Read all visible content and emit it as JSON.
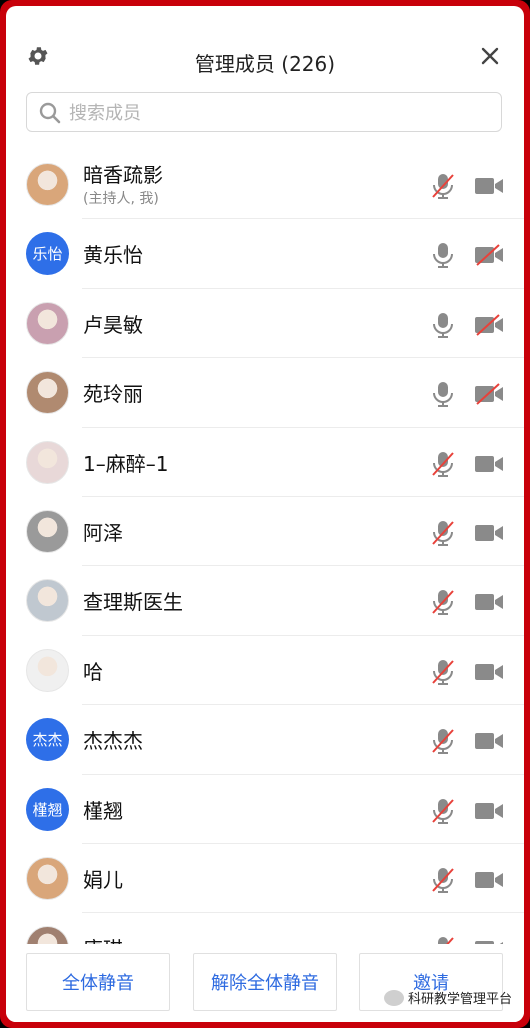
{
  "header": {
    "title": "管理成员 (226)"
  },
  "search": {
    "placeholder": "搜索成员"
  },
  "members": [
    {
      "name": "暗香疏影",
      "sub": "(主持人, 我)",
      "avatar": "photo",
      "mic": "muted",
      "cam": "on"
    },
    {
      "name": "黄乐怡",
      "avatar_text": "乐怡",
      "mic": "on",
      "cam": "off"
    },
    {
      "name": "卢昊敏",
      "avatar": "photo",
      "mic": "on",
      "cam": "off"
    },
    {
      "name": "苑玲丽",
      "avatar": "photo",
      "mic": "on",
      "cam": "off"
    },
    {
      "name": "1–麻醉–1",
      "avatar": "photo",
      "mic": "muted",
      "cam": "on"
    },
    {
      "name": "阿泽",
      "avatar": "photo",
      "mic": "muted",
      "cam": "on"
    },
    {
      "name": "查理斯医生",
      "avatar": "photo",
      "mic": "muted",
      "cam": "on"
    },
    {
      "name": "哈",
      "avatar": "photo",
      "mic": "muted",
      "cam": "on"
    },
    {
      "name": "杰杰杰",
      "avatar_text": "杰杰",
      "mic": "muted",
      "cam": "on"
    },
    {
      "name": "槿翘",
      "avatar_text": "槿翘",
      "mic": "muted",
      "cam": "on"
    },
    {
      "name": "娟儿",
      "avatar": "photo",
      "mic": "muted",
      "cam": "on"
    },
    {
      "name": "唐琪",
      "avatar": "photo",
      "mic": "muted",
      "cam": "on"
    }
  ],
  "footer": {
    "mute_all": "全体静音",
    "unmute_all": "解除全体静音",
    "invite": "邀请"
  },
  "watermark": "科研教学管理平台",
  "colors": {
    "frame": "#c8000a",
    "accent": "#2d6ae0",
    "avatar_bg": "#2e6fe8",
    "muted_red": "#e8413a",
    "icon_gray": "#8a8a8a"
  }
}
